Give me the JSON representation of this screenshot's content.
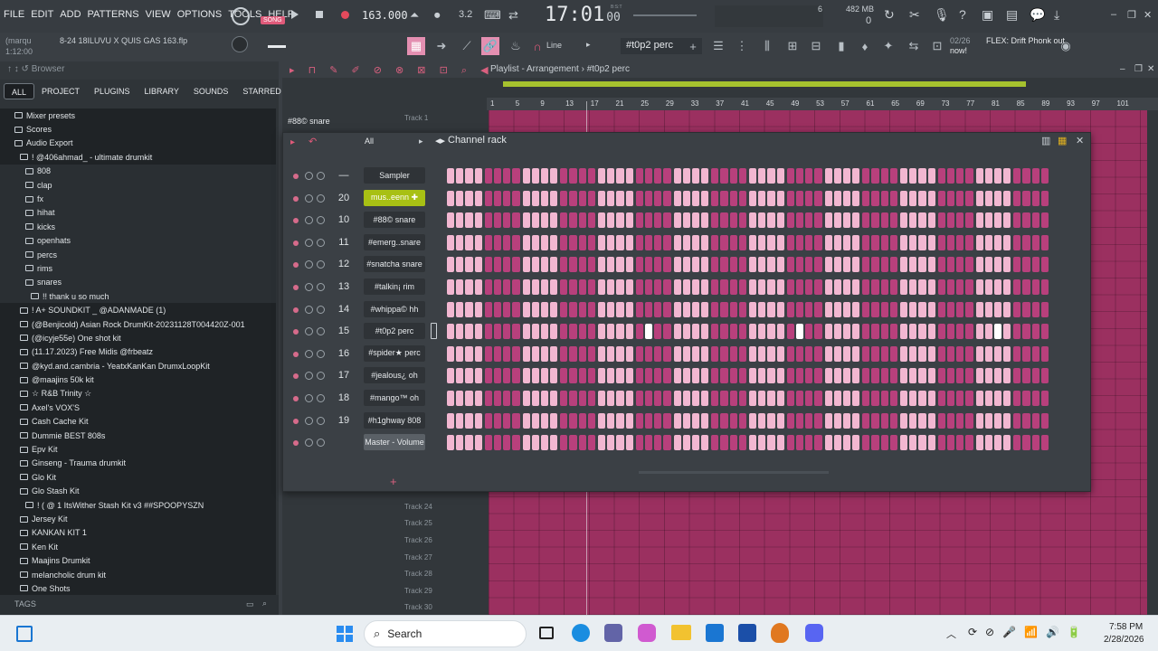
{
  "menu": [
    "FILE",
    "EDIT",
    "ADD",
    "PATTERNS",
    "VIEW",
    "OPTIONS",
    "TOOLS",
    "HELP"
  ],
  "transport": {
    "song_mode": "SONG",
    "tempo": "163.000",
    "time": "17:01",
    "time_ms": "00",
    "meter_label": "B:S:T",
    "cpu": "6",
    "memory": "482 MB",
    "voices": "0"
  },
  "project": {
    "user": "(marqu",
    "file": "8-24 18ILUVU X QUIS GAS 163.flp",
    "position": "1:12:00",
    "hint_counter": "02/26",
    "hint": "FLEX: Drift Phonk out now!"
  },
  "toolbar": {
    "snap": "Line",
    "pattern": "#t0p2 perc"
  },
  "browser": {
    "title": "Browser",
    "tabs": [
      "ALL",
      "PROJECT",
      "PLUGINS",
      "LIBRARY",
      "SOUNDS",
      "STARRED"
    ],
    "items": [
      {
        "label": "Mixer presets",
        "indent": 0
      },
      {
        "label": "Scores",
        "indent": 0
      },
      {
        "label": "Audio Export",
        "indent": 0
      },
      {
        "label": "! @406ahmad_ - ultimate drumkit",
        "indent": 1
      },
      {
        "label": "808",
        "indent": 2
      },
      {
        "label": "clap",
        "indent": 2
      },
      {
        "label": "fx",
        "indent": 2
      },
      {
        "label": "hihat",
        "indent": 2
      },
      {
        "label": "kicks",
        "indent": 2
      },
      {
        "label": "openhats",
        "indent": 2
      },
      {
        "label": "percs",
        "indent": 2
      },
      {
        "label": "rims",
        "indent": 2
      },
      {
        "label": "snares",
        "indent": 2
      },
      {
        "label": "!! thank u so much",
        "indent": 3
      },
      {
        "label": "! A+ SOUNDKIT _ @ADANMADE (1)",
        "indent": 1
      },
      {
        "label": "(@Benjicold) Asian Rock DrumKit-20231128T004420Z-001",
        "indent": 1
      },
      {
        "label": "(@icyje55e) One shot kit",
        "indent": 1
      },
      {
        "label": "(11.17.2023) Free Midis @frbeatz",
        "indent": 1
      },
      {
        "label": "@kyd.and.cambria - YeatxKanKan DrumxLoopKit",
        "indent": 1
      },
      {
        "label": "@maajins 50k kit",
        "indent": 1
      },
      {
        "label": "☆ R&B Trinity ☆",
        "indent": 1
      },
      {
        "label": "Axel's VOX'S",
        "indent": 1
      },
      {
        "label": "Cash Cache Kit",
        "indent": 1
      },
      {
        "label": "Dummie BEST 808s",
        "indent": 1
      },
      {
        "label": "Epv Kit",
        "indent": 1
      },
      {
        "label": "Ginseng - Trauma drumkit",
        "indent": 1
      },
      {
        "label": "Glo Kit",
        "indent": 1
      },
      {
        "label": "Glo Stash Kit",
        "indent": 1
      },
      {
        "label": "! ( @ 1 ItsWither Stash Kit v3 ##SPOOPYSZN",
        "indent": 2
      },
      {
        "label": "Jersey Kit",
        "indent": 1
      },
      {
        "label": "KANKAN KIT 1",
        "indent": 1
      },
      {
        "label": "Ken Kit",
        "indent": 1
      },
      {
        "label": "Maajins Drumkit",
        "indent": 1
      },
      {
        "label": "melancholic drum kit",
        "indent": 1
      },
      {
        "label": "One Shots",
        "indent": 1
      }
    ],
    "tags": "TAGS"
  },
  "playlist": {
    "title": "Playlist - Arrangement",
    "pattern": "#t0p2 perc",
    "current_track": "#88© snare",
    "ruler": [
      "1",
      "5",
      "9",
      "13",
      "17",
      "21",
      "25",
      "29",
      "33",
      "37",
      "41",
      "45",
      "49",
      "53",
      "57",
      "61",
      "65",
      "69",
      "73",
      "77",
      "81",
      "85",
      "89",
      "93",
      "97",
      "101"
    ],
    "tracks": [
      "Track 1",
      "Track 24",
      "Track 25",
      "Track 26",
      "Track 27",
      "Track 28",
      "Track 29",
      "Track 30"
    ]
  },
  "rack": {
    "title": "Channel rack",
    "filter": "All",
    "channels": [
      {
        "num": "—",
        "name": "Sampler"
      },
      {
        "num": "20",
        "name": "mus..eenn ✚",
        "selected": true
      },
      {
        "num": "10",
        "name": "#88© snare"
      },
      {
        "num": "11",
        "name": "#emerg..snare"
      },
      {
        "num": "12",
        "name": "#snatcha snare"
      },
      {
        "num": "13",
        "name": "#talkin¡ rim"
      },
      {
        "num": "14",
        "name": "#whippa© hh"
      },
      {
        "num": "15",
        "name": "#t0p2 perc",
        "active": true
      },
      {
        "num": "16",
        "name": "#spider★ perc"
      },
      {
        "num": "17",
        "name": "#jealous¿ oh"
      },
      {
        "num": "18",
        "name": "#mango™ oh"
      },
      {
        "num": "19",
        "name": "#h1ghway 808"
      },
      {
        "num": "",
        "name": "Master - Volume",
        "master": true
      }
    ],
    "active_steps": {
      "7": [
        21,
        37,
        58
      ]
    }
  },
  "taskbar": {
    "search": "Search",
    "time": "7:58 PM",
    "date": "2/28/2026"
  },
  "colors": {
    "step_light": "#f2b7d1",
    "step_dark": "#b8407c",
    "selected_channel": "#a8c014",
    "playlist_grid": "#9b3060"
  }
}
